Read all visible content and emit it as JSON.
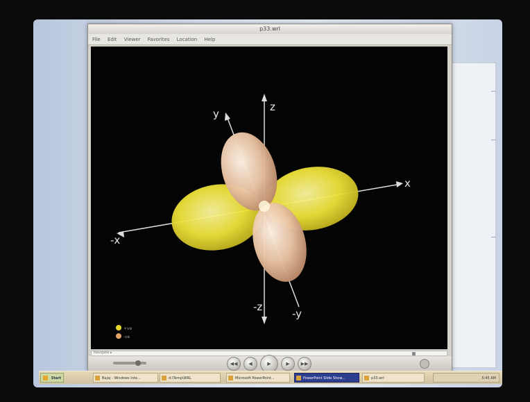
{
  "window": {
    "title": "p33.wrl"
  },
  "menu": [
    "File",
    "Edit",
    "Viewer",
    "Favorites",
    "Location",
    "Help"
  ],
  "scene": {
    "axes": {
      "z": "z",
      "neg_z": "-z",
      "y": "y",
      "neg_y": "-y",
      "x": "x",
      "neg_x": "-x"
    },
    "legend": [
      {
        "color": "#e8d82a",
        "label": "+ve"
      },
      {
        "color": "#e3a468",
        "label": "-ve"
      }
    ],
    "colors": {
      "positive_lobe": "#efe33a",
      "negative_lobe": "#e9c3a3",
      "background": "#040404"
    }
  },
  "playback": {
    "seek_label": "Navigate ▸"
  },
  "taskbar": {
    "start_label": "Start",
    "items": [
      "Bajaj - Windows Inte...",
      "d:\\Temp\\WRL",
      "Microsoft PowerPoint...",
      "PowerPoint Slide Show...",
      "p33.wrl"
    ],
    "clock": "5:45 AM"
  }
}
